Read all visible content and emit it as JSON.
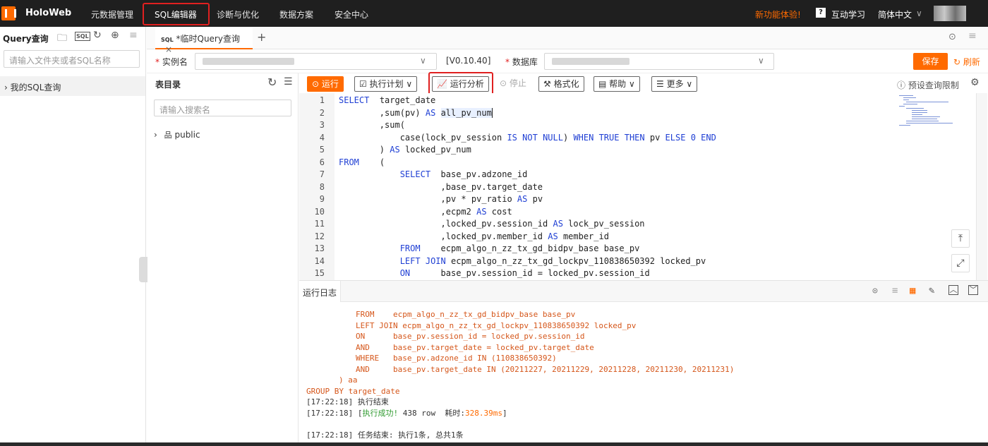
{
  "topbar": {
    "brand": "HoloWeb",
    "nav": [
      "元数据管理",
      "SQL编辑器",
      "诊断与优化",
      "数据方案",
      "安全中心"
    ],
    "new_feature": "新功能体验!",
    "learn": "互动学习",
    "lang": "简体中文"
  },
  "left": {
    "title": "Query查询",
    "search_placeholder": "请输入文件夹或者SQL名称",
    "my_sql": "我的SQL查询"
  },
  "tab": {
    "label": "*临时Query查询",
    "sql_tag": "SQL"
  },
  "instance": {
    "instance_label": "实例名",
    "version": "[V0.10.40]",
    "db_label": "数据库",
    "save": "保存",
    "refresh": "刷新"
  },
  "dir": {
    "title": "表目录",
    "search_placeholder": "请输入搜索名",
    "schema": "public"
  },
  "toolbar": {
    "run": "运行",
    "plan": "执行计划",
    "analyze": "运行分析",
    "stop": "停止",
    "format": "格式化",
    "help": "帮助",
    "more": "更多",
    "limit": "预设查询限制"
  },
  "editor": {
    "lines": [
      {
        "n": "1",
        "t": "SELECT  target_date"
      },
      {
        "n": "2",
        "t": "        ,sum(pv) AS all_pv_num"
      },
      {
        "n": "3",
        "t": "        ,sum("
      },
      {
        "n": "4",
        "t": "            case(lock_pv_session IS NOT NULL) WHEN TRUE THEN pv ELSE 0 END"
      },
      {
        "n": "5",
        "t": "        ) AS locked_pv_num"
      },
      {
        "n": "6",
        "t": "FROM    ("
      },
      {
        "n": "7",
        "t": "            SELECT  base_pv.adzone_id"
      },
      {
        "n": "8",
        "t": "                    ,base_pv.target_date"
      },
      {
        "n": "9",
        "t": "                    ,pv * pv_ratio AS pv"
      },
      {
        "n": "10",
        "t": "                    ,ecpm2 AS cost"
      },
      {
        "n": "11",
        "t": "                    ,locked_pv.session_id AS lock_pv_session"
      },
      {
        "n": "12",
        "t": "                    ,locked_pv.member_id AS member_id"
      },
      {
        "n": "13",
        "t": "            FROM    ecpm_algo_n_zz_tx_gd_bidpv_base base_pv"
      },
      {
        "n": "14",
        "t": "            LEFT JOIN ecpm_algo_n_zz_tx_gd_lockpv_110838650392 locked_pv"
      },
      {
        "n": "15",
        "t": "            ON      base_pv.session_id = locked_pv.session_id"
      }
    ]
  },
  "log": {
    "tab": "运行日志",
    "sql_lines": [
      "FROM    ecpm_algo_n_zz_tx_gd_bidpv_base base_pv",
      "LEFT JOIN ecpm_algo_n_zz_tx_gd_lockpv_110838650392 locked_pv",
      "ON      base_pv.session_id = locked_pv.session_id",
      "AND     base_pv.target_date = locked_pv.target_date",
      "WHERE   base_pv.adzone_id IN (110838650392)",
      "AND     base_pv.target_date IN (20211227, 20211229, 20211228, 20211230, 20211231)"
    ],
    "close_paren": ") aa",
    "group_by": "GROUP BY target_date",
    "end_line": "[17:22:18] 执行结束",
    "success_time": "[17:22:18] [",
    "success_word": "执行成功!",
    "success_rows": " 438 row  耗时:",
    "success_ms": "328.39ms",
    "success_close": "]",
    "task_end": "[17:22:18] 任务结束: 执行1条, 总共1条"
  }
}
